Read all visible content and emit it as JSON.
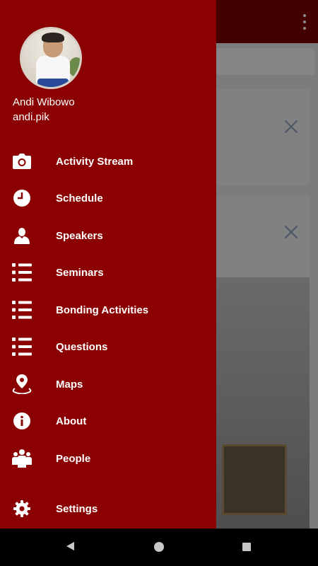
{
  "user": {
    "name": "Andi Wibowo",
    "handle": "andi.pik"
  },
  "menu": {
    "items": [
      {
        "label": "Activity Stream",
        "icon": "camera-icon"
      },
      {
        "label": "Schedule",
        "icon": "clock-icon"
      },
      {
        "label": "Speakers",
        "icon": "person-icon"
      },
      {
        "label": "Seminars",
        "icon": "list-icon"
      },
      {
        "label": "Bonding Activities",
        "icon": "list-icon"
      },
      {
        "label": "Questions",
        "icon": "list-icon"
      },
      {
        "label": "Maps",
        "icon": "map-pin-icon"
      },
      {
        "label": "About",
        "icon": "info-icon"
      },
      {
        "label": "People",
        "icon": "group-icon"
      },
      {
        "label": "Settings",
        "icon": "gear-icon"
      }
    ]
  },
  "colors": {
    "drawer_bg": "#8b0000",
    "appbar_dim": "#420000",
    "text": "#ffffff"
  }
}
